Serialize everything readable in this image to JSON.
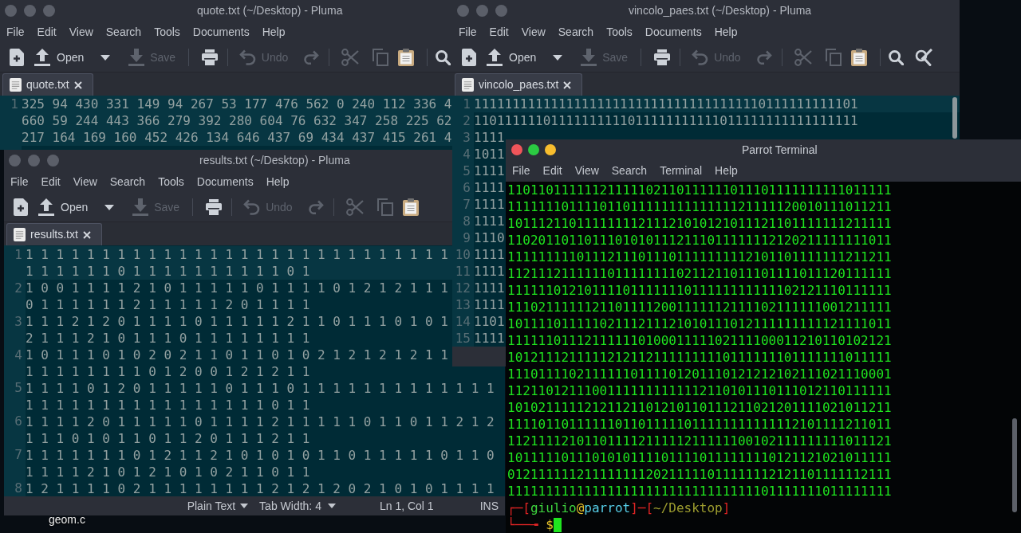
{
  "desktop_icons": [
    {
      "label": "geom.c"
    }
  ],
  "windows": [
    {
      "kind": "editor",
      "title": "quote.txt (~/Desktop) - Pluma",
      "menus": [
        "File",
        "Edit",
        "View",
        "Search",
        "Tools",
        "Documents",
        "Help"
      ],
      "toolbar_groups": [
        [
          {
            "kind": "new",
            "disabled": false
          },
          {
            "kind": "open",
            "label": "Open",
            "disabled": false
          },
          {
            "kind": "dropdown",
            "disabled": false
          },
          {
            "kind": "save",
            "label": "Save",
            "disabled": true
          }
        ],
        [
          {
            "kind": "print",
            "disabled": false
          }
        ],
        [
          {
            "kind": "undo",
            "label": "Undo",
            "disabled": true
          },
          {
            "kind": "redo",
            "disabled": true
          }
        ],
        [
          {
            "kind": "cut",
            "disabled": true
          },
          {
            "kind": "copy",
            "disabled": true
          },
          {
            "kind": "paste",
            "disabled": false
          }
        ],
        [
          {
            "kind": "find",
            "disabled": false
          }
        ]
      ],
      "tabs": [
        {
          "label": "quote.txt",
          "selected": true
        }
      ],
      "lines": [
        {
          "number": "1",
          "current": true,
          "rows": [
            "325 94 430 331 149 94 267 53 177 476 562 0 240 112 336 4",
            "660 59 244 443 366 279 392 280 604 76 632 347 258 225 62",
            "217 164 169 160 452 426 134 646 437 69 434 437 415 261 4"
          ]
        }
      ]
    },
    {
      "kind": "editor",
      "title": "results.txt (~/Desktop) - Pluma",
      "menus": [
        "File",
        "Edit",
        "View",
        "Search",
        "Tools",
        "Documents",
        "Help"
      ],
      "toolbar_groups": [
        [
          {
            "kind": "new",
            "disabled": false
          },
          {
            "kind": "open",
            "label": "Open",
            "disabled": false
          },
          {
            "kind": "dropdown",
            "disabled": false
          },
          {
            "kind": "save",
            "label": "Save",
            "disabled": true
          }
        ],
        [
          {
            "kind": "print",
            "disabled": false
          }
        ],
        [
          {
            "kind": "undo",
            "label": "Undo",
            "disabled": true
          },
          {
            "kind": "redo",
            "disabled": true
          }
        ],
        [
          {
            "kind": "cut",
            "disabled": true
          },
          {
            "kind": "copy",
            "disabled": true
          },
          {
            "kind": "paste",
            "disabled": false
          }
        ]
      ],
      "tabs": [
        {
          "label": "results.txt",
          "selected": true
        }
      ],
      "lines": [
        {
          "number": "1",
          "current": true,
          "rows": [
            "1 1 1 1 1 1 1 1 1 1 1 1 1 1 1 1 1 1 1 1 1 1 1 1 1 1 1 1",
            "1 1 1 1 1 1 0 1 1 1 1 1 1 1 1 1 1 0 1"
          ]
        },
        {
          "number": "2",
          "current": false,
          "rows": [
            "1 0 0 1 1 1 1 2 1 0 1 1 1 1 1 0 1 1 1 1 0 1 2 1 2 1 1 1",
            "0 1 1 1 1 1 1 2 1 1 1 1 1 2 0 1 1 1 1"
          ]
        },
        {
          "number": "3",
          "current": false,
          "rows": [
            "1 1 1 2 1 2 0 1 1 1 1 0 1 1 1 1 1 2 1 1 0 1 1 1 0 1 0 1",
            "2 1 1 1 2 1 0 1 1 1 0 1 1 1 1 1 1 1 1"
          ]
        },
        {
          "number": "4",
          "current": false,
          "rows": [
            "1 0 1 1 1 0 1 0 2 0 2 1 1 0 1 1 0 1 0 2 1 2 1 2 1 2 1 1",
            "1 1 1 1 1 1 1 1 0 1 2 0 0 1 2 1 2 1 1"
          ]
        },
        {
          "number": "5",
          "current": false,
          "rows": [
            "1 1 1 1 0 1 2 0 1 1 1 1 1 0 1 1 1 0 1 1 1 1 1 1 1 1 1 1 1 1 1",
            "1 1 1 1 1 1 1 1 1 1 1 1 1 1 1 1 0 1 1"
          ]
        },
        {
          "number": "6",
          "current": false,
          "rows": [
            "1 1 1 1 2 0 1 1 1 1 1 0 1 1 1 1 2 1 1 1 1 1 0 1 1 0 1 1 2 1 2",
            "1 1 1 0 1 0 1 1 0 1 1 2 0 1 1 1 2 1 1"
          ]
        },
        {
          "number": "7",
          "current": false,
          "rows": [
            "1 1 1 1 1 1 1 0 1 2 1 1 2 1 0 1 0 1 0 1 1 0 1 1 1 1 1 0 1 1 0",
            "1 1 1 1 2 1 0 1 2 1 0 1 0 2 1 1 0 1 1"
          ]
        },
        {
          "number": "8",
          "current": false,
          "rows": [
            "1 2 1 1 1 1 0 2 1 1 1 1 1 1 1 1 2 1 2 1 2 0 2 1 0 1 0 1 1 1 1"
          ]
        }
      ],
      "status_bar": {
        "language": "Plain Text",
        "tab_width": "Tab Width: 4",
        "position": "Ln 1, Col 1",
        "mode": "INS"
      }
    },
    {
      "kind": "editor",
      "title": "vincolo_paes.txt (~/Desktop) - Pluma",
      "menus": [
        "File",
        "Edit",
        "View",
        "Search",
        "Tools",
        "Documents",
        "Help"
      ],
      "toolbar_groups": [
        [
          {
            "kind": "new",
            "disabled": false
          },
          {
            "kind": "open",
            "label": "Open",
            "disabled": false
          },
          {
            "kind": "dropdown",
            "disabled": false
          },
          {
            "kind": "save",
            "label": "Save",
            "disabled": true
          }
        ],
        [
          {
            "kind": "print",
            "disabled": false
          }
        ],
        [
          {
            "kind": "undo",
            "label": "Undo",
            "disabled": true
          },
          {
            "kind": "redo",
            "disabled": true
          }
        ],
        [
          {
            "kind": "cut",
            "disabled": true
          },
          {
            "kind": "copy",
            "disabled": true
          },
          {
            "kind": "paste",
            "disabled": false
          }
        ],
        [
          {
            "kind": "find",
            "disabled": false
          },
          {
            "kind": "replace",
            "disabled": false
          }
        ]
      ],
      "tabs": [
        {
          "label": "vincolo_paes.txt",
          "selected": true
        }
      ],
      "lines": [
        {
          "number": "1",
          "current": true,
          "rows": [
            "11111111111111111111111111111111111110111111111101"
          ]
        },
        {
          "number": "2",
          "current": false,
          "rows": [
            "11011111101111111111011111111111011111111111111111"
          ]
        },
        {
          "number": "3",
          "current": false,
          "rows": [
            "1111"
          ]
        },
        {
          "number": "4",
          "current": false,
          "rows": [
            "1011"
          ]
        },
        {
          "number": "5",
          "current": false,
          "rows": [
            "1111"
          ]
        },
        {
          "number": "6",
          "current": false,
          "rows": [
            "1111"
          ]
        },
        {
          "number": "7",
          "current": false,
          "rows": [
            "1111"
          ]
        },
        {
          "number": "8",
          "current": false,
          "rows": [
            "1111"
          ]
        },
        {
          "number": "9",
          "current": false,
          "rows": [
            "1110"
          ]
        },
        {
          "number": "10",
          "current": false,
          "rows": [
            "1111"
          ]
        },
        {
          "number": "11",
          "current": false,
          "rows": [
            "1111"
          ]
        },
        {
          "number": "12",
          "current": false,
          "rows": [
            "1111"
          ]
        },
        {
          "number": "13",
          "current": false,
          "rows": [
            "1111"
          ]
        },
        {
          "number": "14",
          "current": false,
          "rows": [
            "1101"
          ]
        },
        {
          "number": "15",
          "current": false,
          "rows": [
            "1111"
          ]
        }
      ]
    },
    {
      "kind": "terminal",
      "title": "Parrot Terminal",
      "menus": [
        "File",
        "Edit",
        "View",
        "Search",
        "Terminal",
        "Help"
      ],
      "output": [
        "11011011111121111102110111111011101111111111011111",
        "11111110111101101111111111111121111120010111011211",
        "10111211011111111211121010121011121101111111211111",
        "11020110110111010101112111011111112120211111111011",
        "11111111101112111011101111111112101101111111211211",
        "11211121111110111111110211211011101111011120111111",
        "11111101210111101111111011111111111102121110111111",
        "11102111111211011112001111112111102111111001211111",
        "10111101111102111211121010111012111111111121111011",
        "11111101112111111010001111102111100011210110102121",
        "10121112111112121121111111110111111101111111011111",
        "11101111021111110111101201110121212102111021110001",
        "11211012111001111111111112110101110111012110111111",
        "10102111112121121101210110111211021201111021011211",
        "11110110111111011011111011111111111112101111211011",
        "11211112101101111211111211111100102111111111011121",
        "10111110111010101111011110111111110121121021011111",
        "01211111121111111120211111011111112121101111112111",
        "11111111111111111111111111111111101111111011111111"
      ],
      "prompt": {
        "open": "┌─[",
        "user": "giulio",
        "at": "@",
        "host": "parrot",
        "separator": "]─[",
        "path": "~/Desktop",
        "close": "]",
        "corner": "└──╼",
        "symbol": "$"
      }
    }
  ]
}
